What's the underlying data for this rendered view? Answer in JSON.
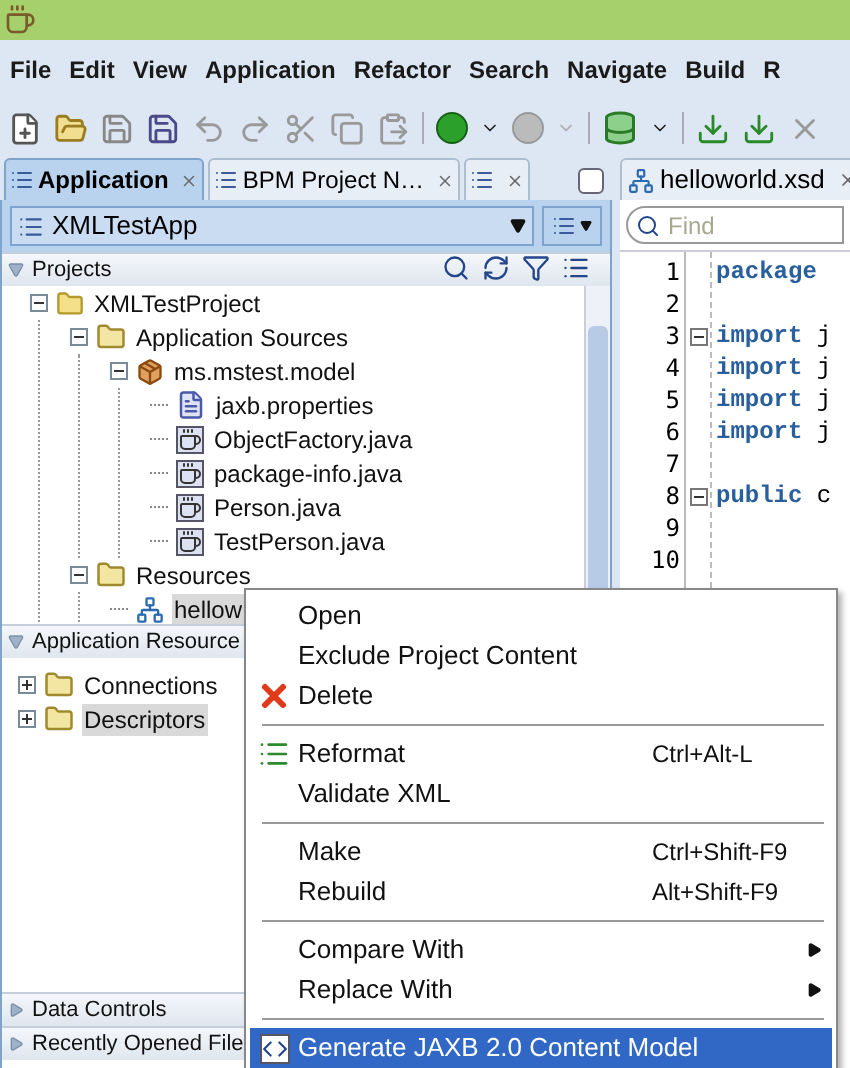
{
  "menu_bar": [
    {
      "label": "File"
    },
    {
      "label": "Edit"
    },
    {
      "label": "View"
    },
    {
      "label": "Application"
    },
    {
      "label": "Refactor"
    },
    {
      "label": "Search"
    },
    {
      "label": "Navigate"
    },
    {
      "label": "Build"
    },
    {
      "label": "R"
    }
  ],
  "left_tabs": [
    {
      "kind": "text",
      "label": "Application",
      "selected": true
    },
    {
      "kind": "text",
      "label": "BPM Project N…",
      "selected": false
    },
    {
      "kind": "icon",
      "selected": false
    }
  ],
  "app_selector": {
    "value": "XMLTestApp"
  },
  "projects_panel": {
    "title": "Projects",
    "expanded": true,
    "tree": [
      {
        "label": "XMLTestProject",
        "kind": "project",
        "expanded": true,
        "selected": false,
        "children": [
          {
            "label": "Application Sources",
            "kind": "folder",
            "expanded": true,
            "selected": false,
            "children": [
              {
                "label": "ms.mstest.model",
                "kind": "package",
                "expanded": true,
                "selected": false,
                "children": [
                  {
                    "label": "jaxb.properties",
                    "kind": "properties",
                    "selected": false
                  },
                  {
                    "label": "ObjectFactory.java",
                    "kind": "java",
                    "selected": false
                  },
                  {
                    "label": "package-info.java",
                    "kind": "java",
                    "selected": false
                  },
                  {
                    "label": "Person.java",
                    "kind": "java",
                    "selected": false
                  },
                  {
                    "label": "TestPerson.java",
                    "kind": "java",
                    "selected": false
                  }
                ]
              }
            ]
          },
          {
            "label": "Resources",
            "kind": "folder",
            "expanded": true,
            "selected": false,
            "children": [
              {
                "label": "hellow",
                "kind": "schema",
                "selected": true
              }
            ]
          }
        ]
      }
    ]
  },
  "resources_panel": {
    "title": "Application Resource",
    "expanded": true,
    "tree": [
      {
        "label": "Connections",
        "kind": "folder",
        "expanded": false,
        "selected": false
      },
      {
        "label": "Descriptors",
        "kind": "folder",
        "expanded": false,
        "selected": true
      }
    ]
  },
  "collapsed_panels": [
    {
      "title": "Data Controls",
      "expanded": false
    },
    {
      "title": "Recently Opened File",
      "expanded": false
    }
  ],
  "editor": {
    "tab": {
      "label": "helloworld.xsd"
    },
    "find": {
      "placeholder": "Find"
    },
    "lines": [
      {
        "number": "1",
        "keyword": "package",
        "foldable": false
      },
      {
        "number": "2",
        "foldable": false
      },
      {
        "number": "3",
        "keyword": "import",
        "rest": "j",
        "foldable": true
      },
      {
        "number": "4",
        "keyword": "import",
        "rest": "j",
        "foldable": false
      },
      {
        "number": "5",
        "keyword": "import",
        "rest": "j",
        "foldable": false
      },
      {
        "number": "6",
        "keyword": "import",
        "rest": "j",
        "foldable": false
      },
      {
        "number": "7",
        "foldable": false
      },
      {
        "number": "8",
        "keyword": "public",
        "rest": "c",
        "foldable": true
      },
      {
        "number": "9",
        "foldable": false
      },
      {
        "number": "10",
        "foldable": false
      }
    ]
  },
  "context_menu": {
    "groups": [
      [
        {
          "label": "Open",
          "selected": false,
          "submenu": false
        },
        {
          "label": "Exclude Project Content",
          "selected": false,
          "submenu": false
        },
        {
          "label": "Delete",
          "kind": "delete",
          "selected": false,
          "submenu": false
        }
      ],
      [
        {
          "label": "Reformat",
          "kind": "reformat",
          "shortcut": "Ctrl+Alt-L",
          "selected": false,
          "submenu": false
        },
        {
          "label": "Validate XML",
          "selected": false,
          "submenu": false
        }
      ],
      [
        {
          "label": "Make",
          "shortcut": "Ctrl+Shift-F9",
          "selected": false,
          "submenu": false
        },
        {
          "label": "Rebuild",
          "shortcut": "Alt+Shift-F9",
          "selected": false,
          "submenu": false
        }
      ],
      [
        {
          "label": "Compare With",
          "selected": false,
          "submenu": true
        },
        {
          "label": "Replace With",
          "selected": false,
          "submenu": true
        }
      ],
      [
        {
          "label": "Generate JAXB 2.0 Content Model",
          "kind": "generate",
          "selected": true,
          "submenu": false
        }
      ]
    ]
  }
}
